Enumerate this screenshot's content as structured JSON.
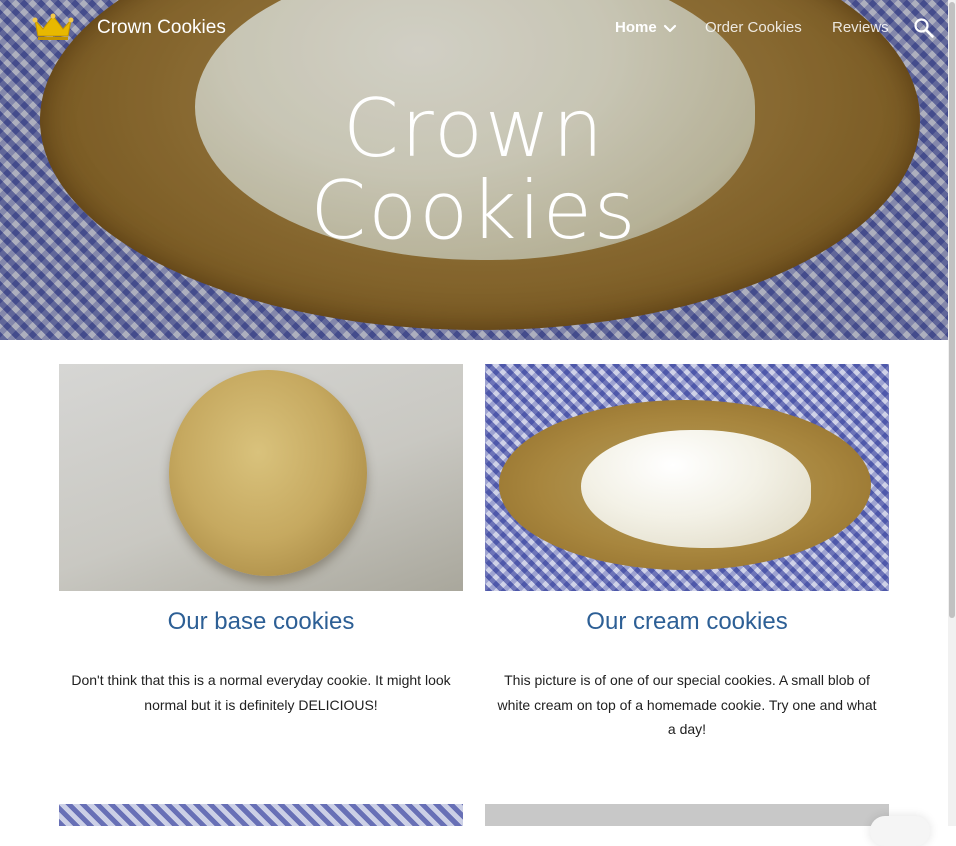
{
  "site": {
    "name": "Crown Cookies",
    "logo_icon": "crown-icon",
    "hero_title_line1": "Crown",
    "hero_title_line2": "Cookies"
  },
  "nav": {
    "items": [
      {
        "label": "Home",
        "active": true,
        "has_dropdown": true
      },
      {
        "label": "Order Cookies",
        "active": false
      },
      {
        "label": "Reviews",
        "active": false
      }
    ],
    "search_icon": "search-icon"
  },
  "cards": [
    {
      "title": "Our base cookies",
      "text": "Don't think that this is a normal everyday cookie. It might look normal but it is definitely DELICIOUS!"
    },
    {
      "title": "Our cream cookies",
      "text": "This picture is of one  of our special cookies. A small blob of white cream on top of a homemade cookie. Try one and what a day!"
    }
  ],
  "colors": {
    "heading": "#2d5f95",
    "body_text": "#212121",
    "nav_text": "#ffffff",
    "crown": "#e8b800"
  }
}
